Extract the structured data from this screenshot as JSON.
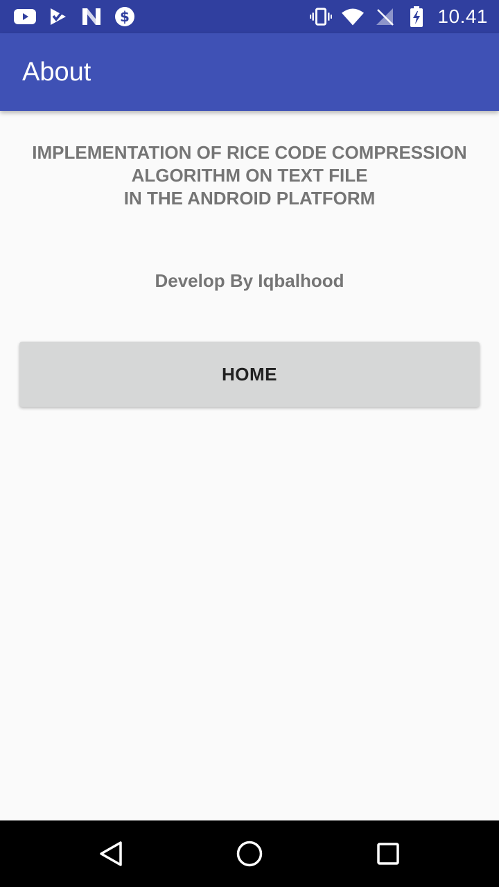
{
  "status_bar": {
    "time": "10.41",
    "background_color": "#303f9f",
    "left_icons": [
      "youtube-icon",
      "checkmark-app-icon",
      "n-app-icon",
      "dollar-icon"
    ],
    "right_icons": [
      "vibrate-icon",
      "wifi-icon",
      "no-signal-icon",
      "battery-charging-icon"
    ]
  },
  "app_bar": {
    "title": "About",
    "background_color": "#3f51b5"
  },
  "main": {
    "project_title_lines": [
      "IMPLEMENTATION OF RICE CODE COMPRESSION",
      "ALGORITHM ON TEXT FILE",
      "IN THE ANDROID PLATFORM"
    ],
    "developer_text": "Develop By Iqbalhood",
    "home_button_label": "HOME"
  },
  "nav_bar": {
    "buttons": [
      "back-icon",
      "home-circle-icon",
      "recents-icon"
    ]
  }
}
